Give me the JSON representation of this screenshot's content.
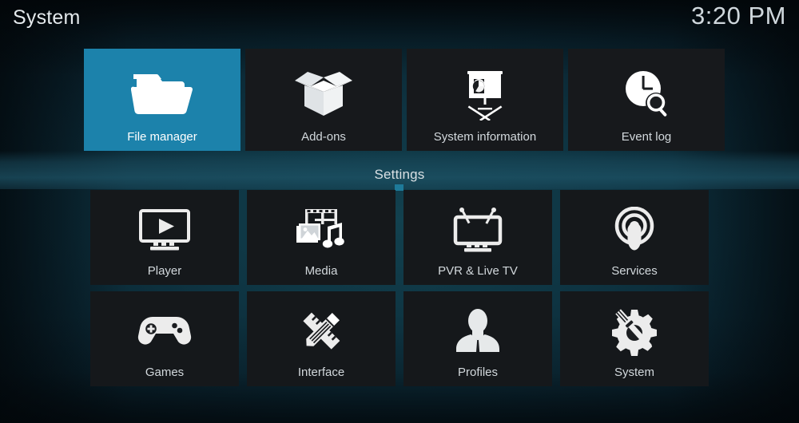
{
  "window": {
    "title": "System",
    "clock": "3:20 PM",
    "accent_color": "#1c82ab",
    "tile_color": "#17191c",
    "background_color": "#0e3442",
    "text_color": "#d2d8dc"
  },
  "top_row": {
    "items": [
      {
        "label": "File manager",
        "icon": "folder-icon",
        "selected": true
      },
      {
        "label": "Add-ons",
        "icon": "open-box-icon",
        "selected": false
      },
      {
        "label": "System information",
        "icon": "presentation-chart-icon",
        "selected": false
      },
      {
        "label": "Event log",
        "icon": "clock-search-icon",
        "selected": false
      }
    ]
  },
  "settings": {
    "heading": "Settings",
    "rows": [
      {
        "items": [
          {
            "label": "Player",
            "icon": "monitor-play-icon"
          },
          {
            "label": "Media",
            "icon": "film-photo-music-icon"
          },
          {
            "label": "PVR & Live TV",
            "icon": "tv-antenna-icon"
          },
          {
            "label": "Services",
            "icon": "broadcast-person-icon"
          }
        ]
      },
      {
        "items": [
          {
            "label": "Games",
            "icon": "gamepad-icon"
          },
          {
            "label": "Interface",
            "icon": "pencil-ruler-icon"
          },
          {
            "label": "Profiles",
            "icon": "person-bust-icon"
          },
          {
            "label": "System",
            "icon": "gear-screwdriver-icon"
          }
        ]
      }
    ]
  }
}
